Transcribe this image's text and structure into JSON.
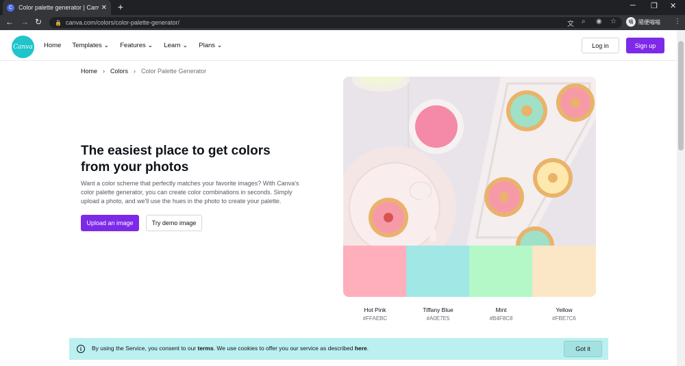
{
  "browser": {
    "tab_title": "Color palette generator | Canva",
    "tab_favicon": "C",
    "url": "canva.com/colors/color-palette-generator/",
    "profile_name": "隨便喵喵",
    "profile_initial": "喵"
  },
  "header": {
    "logo_text": "Canva",
    "nav": [
      "Home",
      "Templates ⌄",
      "Features ⌄",
      "Learn ⌄",
      "Plans ⌄"
    ],
    "login": "Log in",
    "signup": "Sign up"
  },
  "breadcrumb": {
    "home": "Home",
    "colors": "Colors",
    "current": "Color Palette Generator",
    "sep": "›"
  },
  "hero": {
    "title": "The easiest place to get colors from your photos",
    "description": "Want a color scheme that perfectly matches your favorite images? With Canva's color palette generator, you can create color combinations in seconds. Simply upload a photo, and we'll use the hues in the photo to create your palette.",
    "upload_button": "Upload an image",
    "demo_button": "Try demo image"
  },
  "palette": [
    {
      "name": "Hot Pink",
      "hex": "#FFAEBC",
      "color": "#ffaebc"
    },
    {
      "name": "Tiffany Blue",
      "hex": "#A0E7E5",
      "color": "#a0e7e5"
    },
    {
      "name": "Mint",
      "hex": "#B4F8C8",
      "color": "#b4f8c8"
    },
    {
      "name": "Yellow",
      "hex": "#FBE7C6",
      "color": "#fbe7c6"
    }
  ],
  "cookie": {
    "text_before": "By using the Service, you consent to our ",
    "terms": "terms",
    "text_middle": ". We use cookies to offer you our service as described ",
    "here": "here",
    "text_after": ".",
    "button": "Got it"
  }
}
